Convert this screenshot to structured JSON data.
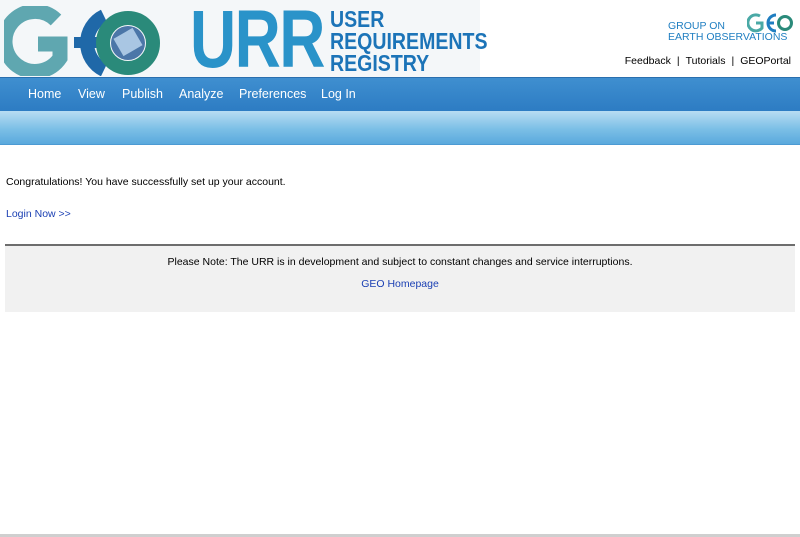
{
  "header": {
    "logo_text": "GEO",
    "urr_letters": "URR",
    "urr_words": [
      "USER",
      "REQUIREMENTS",
      "REGISTRY"
    ],
    "org_logo": {
      "line1": "GROUP ON",
      "line2": "EARTH OBSERVATIONS",
      "mini_text": "GEO"
    },
    "util_links": [
      {
        "label": "Feedback"
      },
      {
        "label": "Tutorials"
      },
      {
        "label": "GEOPortal"
      }
    ],
    "separator": "|"
  },
  "nav": {
    "items": [
      {
        "label": "Home"
      },
      {
        "label": "View"
      },
      {
        "label": "Publish"
      },
      {
        "label": "Analyze"
      },
      {
        "label": "Preferences"
      },
      {
        "label": "Log In"
      }
    ]
  },
  "content": {
    "message": "Congratulations! You have successfully set up your account.",
    "login_link": "Login Now >>"
  },
  "footer": {
    "note": "Please Note: The URR is in development and subject to constant changes and service interruptions.",
    "link": "GEO Homepage"
  },
  "colors": {
    "nav_blue": "#3f8fd0",
    "link_blue": "#1a3fb3",
    "logo_teal": "#4aa9a6",
    "logo_blue": "#1f7ec1"
  }
}
